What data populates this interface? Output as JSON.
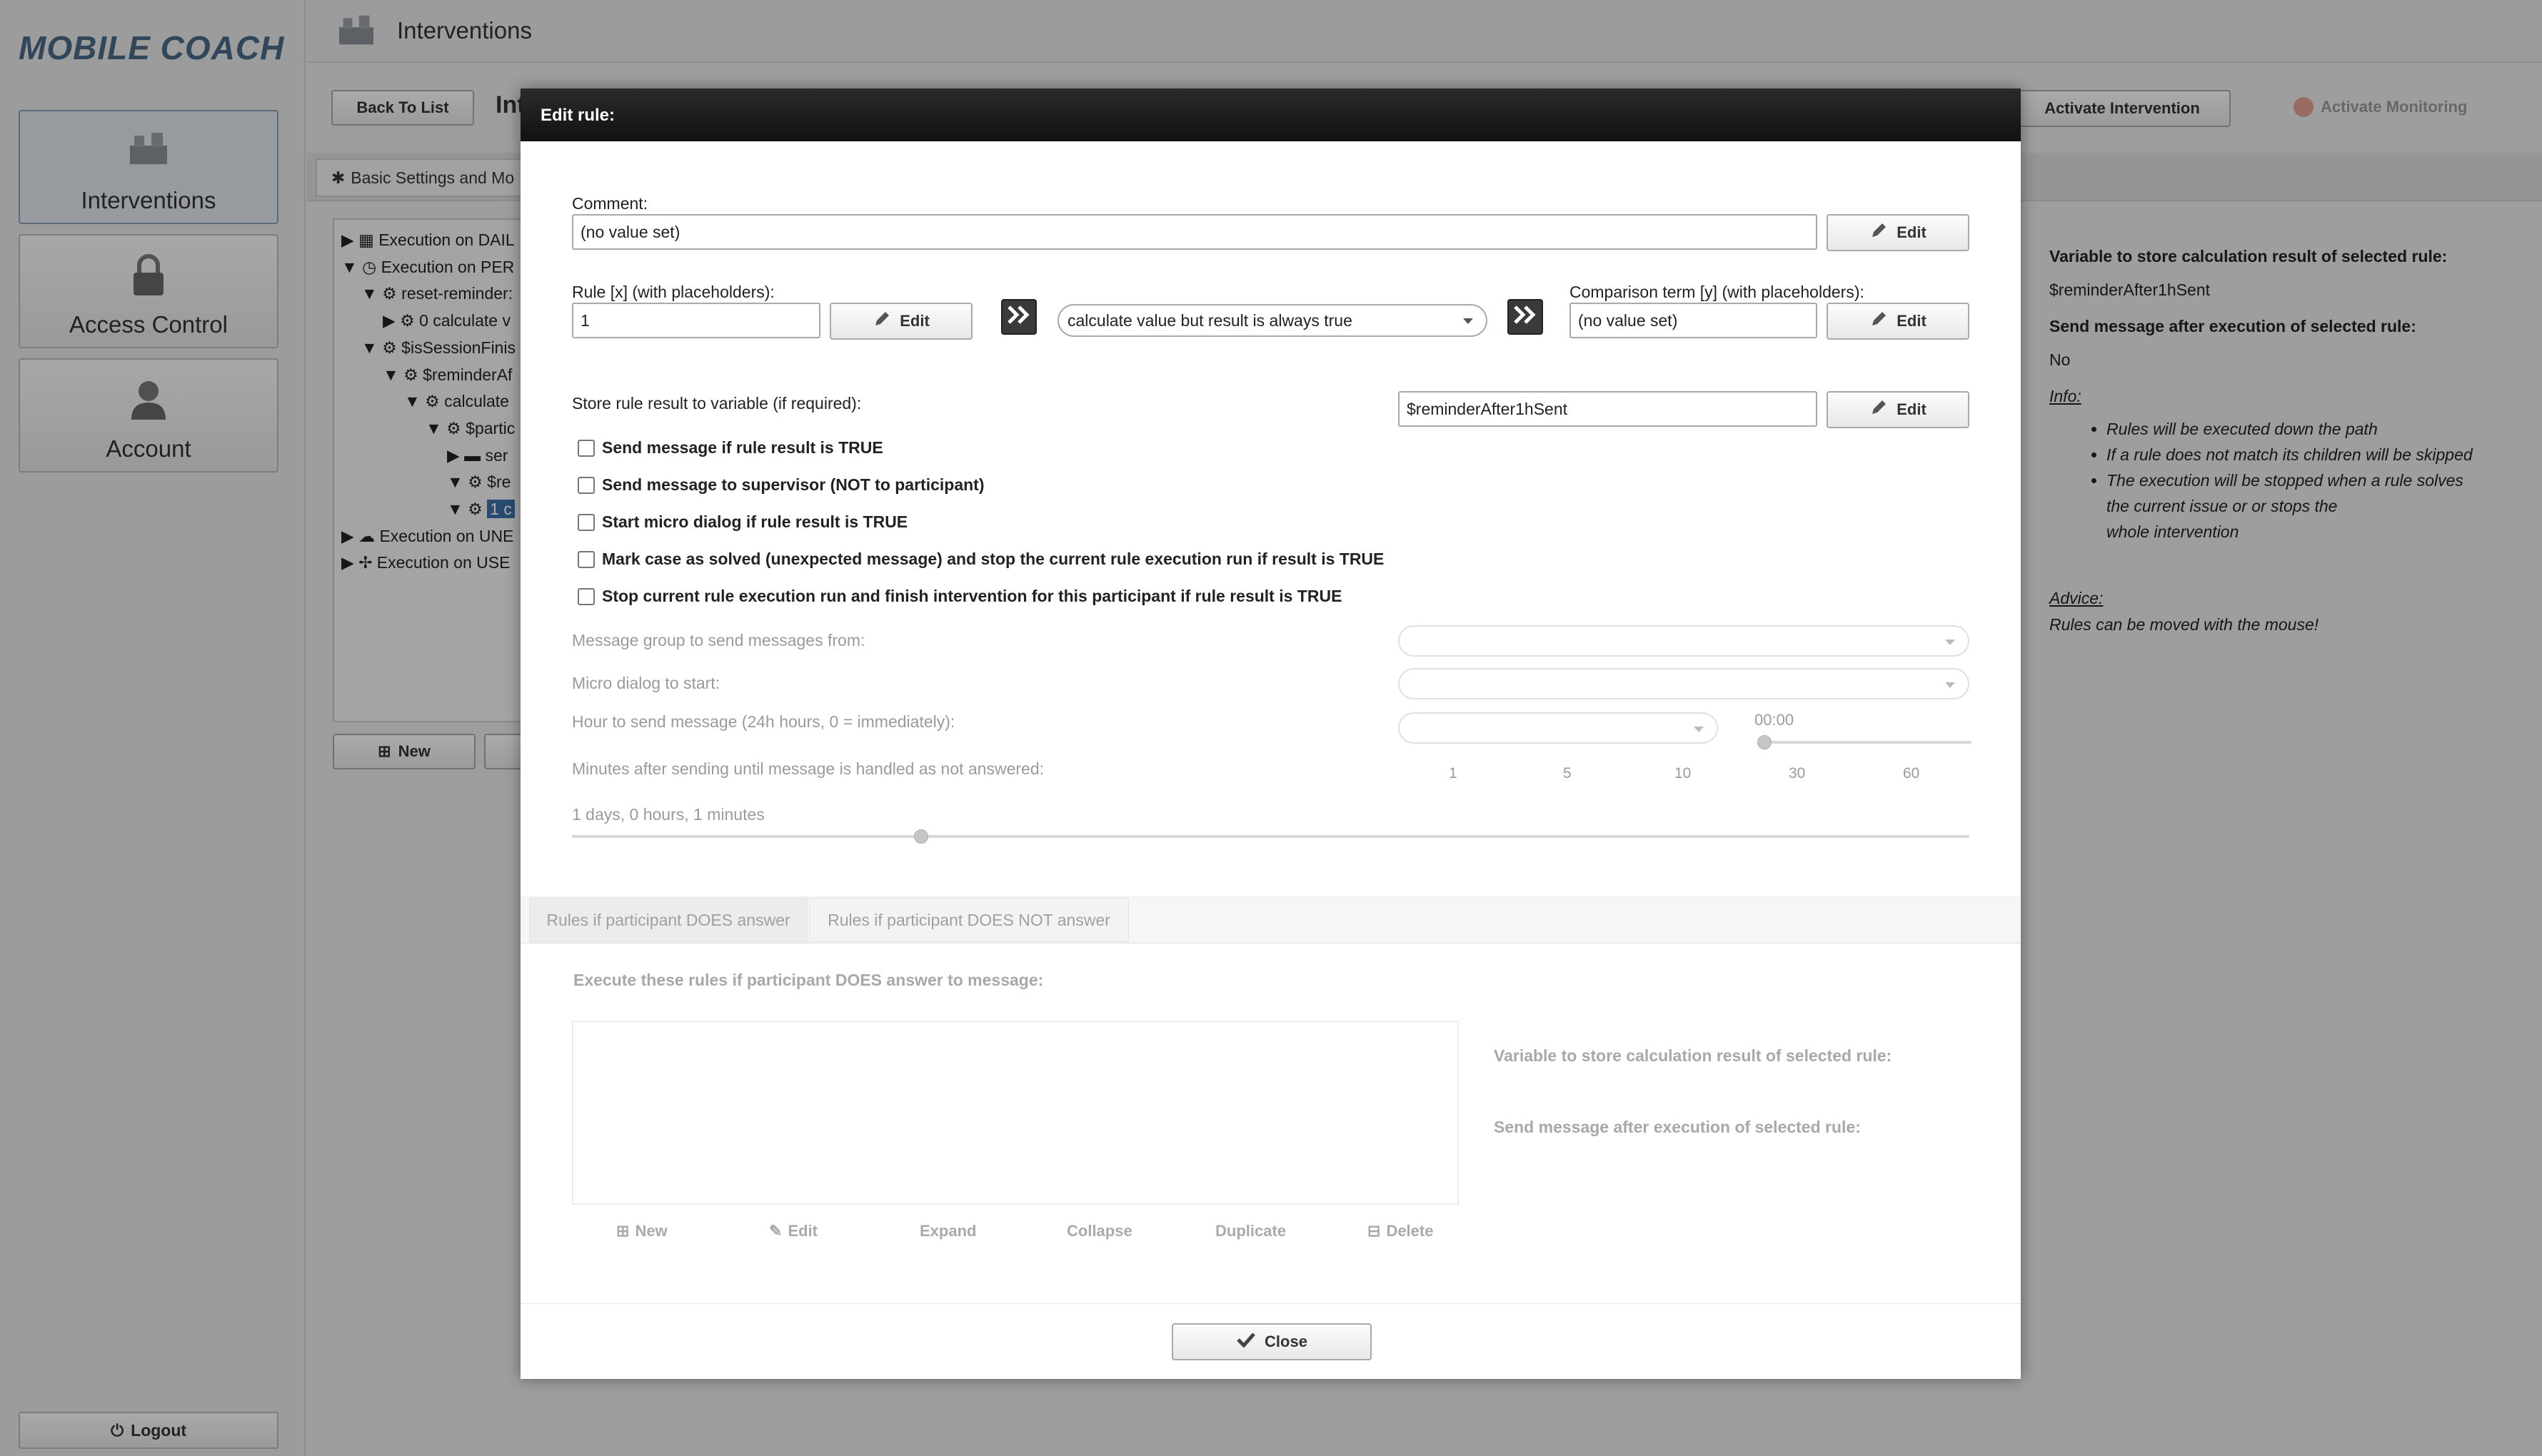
{
  "app": {
    "logo": "MOBILE COACH"
  },
  "sidebar": {
    "items": [
      {
        "label": "Interventions",
        "icon": "interventions-icon",
        "active": true
      },
      {
        "label": "Access Control",
        "icon": "lock-icon"
      },
      {
        "label": "Account",
        "icon": "user-icon"
      }
    ],
    "logout": "Logout"
  },
  "header": {
    "title": "Interventions",
    "back_to_list": "Back To List",
    "title_fragment": "Int",
    "activate_intervention": "Activate Intervention",
    "activate_monitoring": "Activate Monitoring"
  },
  "tabs": {
    "basic": "Basic Settings and Mo"
  },
  "tree": {
    "items": [
      "Execution on DAIL",
      "Execution on PER",
      "reset-reminder:",
      "0 calculate v",
      "$isSessionFinis",
      "$reminderAf",
      "calculate",
      "$partic",
      "ser",
      "$re",
      "1 c",
      "Execution on UNE",
      "Execution on USE"
    ],
    "new_button": "New"
  },
  "rightinfo": {
    "var_label": "Variable to store calculation result of selected rule:",
    "var_value": "$reminderAfter1hSent",
    "send_label": "Send message after execution of selected rule:",
    "send_value": "No",
    "info_label": "Info:",
    "info_items": [
      "Rules will be executed down the path",
      "If a rule does not match its children will be skipped",
      "The execution will be stopped when a rule solves",
      "the current issue or or stops the",
      "whole intervention"
    ],
    "advice_label": "Advice:",
    "advice_text": "Rules can be moved with the mouse!"
  },
  "modal": {
    "title": "Edit rule:",
    "comment_label": "Comment:",
    "comment_value": "(no value set)",
    "edit": "Edit",
    "rule_label": "Rule [x] (with placeholders):",
    "rule_value": "1",
    "operator_value": "calculate value but result is always true",
    "comparison_label": "Comparison term [y] (with placeholders):",
    "comparison_value": "(no value set)",
    "store_label": "Store rule result to variable (if required):",
    "store_value": "$reminderAfter1hSent",
    "checkboxes": [
      "Send message if rule result is TRUE",
      "Send message to supervisor (NOT to participant)",
      "Start micro dialog if rule result is TRUE",
      "Mark case as solved (unexpected message) and stop the current rule execution run if result is TRUE",
      "Stop current rule execution run and finish intervention for this participant if rule result is TRUE"
    ],
    "message_group_label": "Message group to send messages from:",
    "micro_dialog_label": "Micro dialog to start:",
    "hour_label": "Hour to send message (24h hours, 0 = immediately):",
    "hour_value": "00:00",
    "minutes_label": "Minutes after sending until message is handled as not answered:",
    "minute_ticks": [
      "1",
      "5",
      "10",
      "30",
      "60"
    ],
    "duration_text": "1 days, 0 hours, 1 minutes",
    "duration_fraction": 0.25,
    "subtabs": [
      "Rules if participant DOES answer",
      "Rules if participant DOES NOT answer"
    ],
    "execute_label": "Execute these rules if participant DOES answer to message:",
    "sub_var_label": "Variable to store calculation result of selected rule:",
    "sub_send_label": "Send message after execution of selected rule:",
    "footer_actions": [
      "New",
      "Edit",
      "Expand",
      "Collapse",
      "Duplicate",
      "Delete"
    ],
    "close": "Close"
  }
}
